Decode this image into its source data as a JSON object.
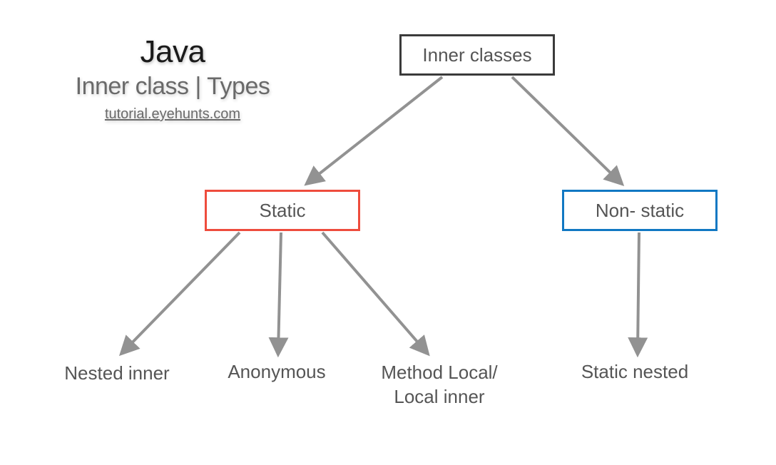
{
  "title": {
    "main": "Java",
    "sub": "Inner class | Types",
    "link": "tutorial.eyehunts.com"
  },
  "nodes": {
    "root": "Inner classes",
    "static": "Static",
    "nonstatic": "Non- static"
  },
  "leaves": {
    "nested_inner": "Nested inner",
    "anonymous": "Anonymous",
    "method_local": "Method Local/ Local inner",
    "static_nested": "Static nested"
  },
  "colors": {
    "root_border": "#3b3b3b",
    "static_border": "#ee4c3d",
    "nonstatic_border": "#1178c3",
    "arrow": "#929292",
    "text_dark": "#1a1a1a",
    "text_gray": "#6a6a6a",
    "text_node": "#555555"
  }
}
